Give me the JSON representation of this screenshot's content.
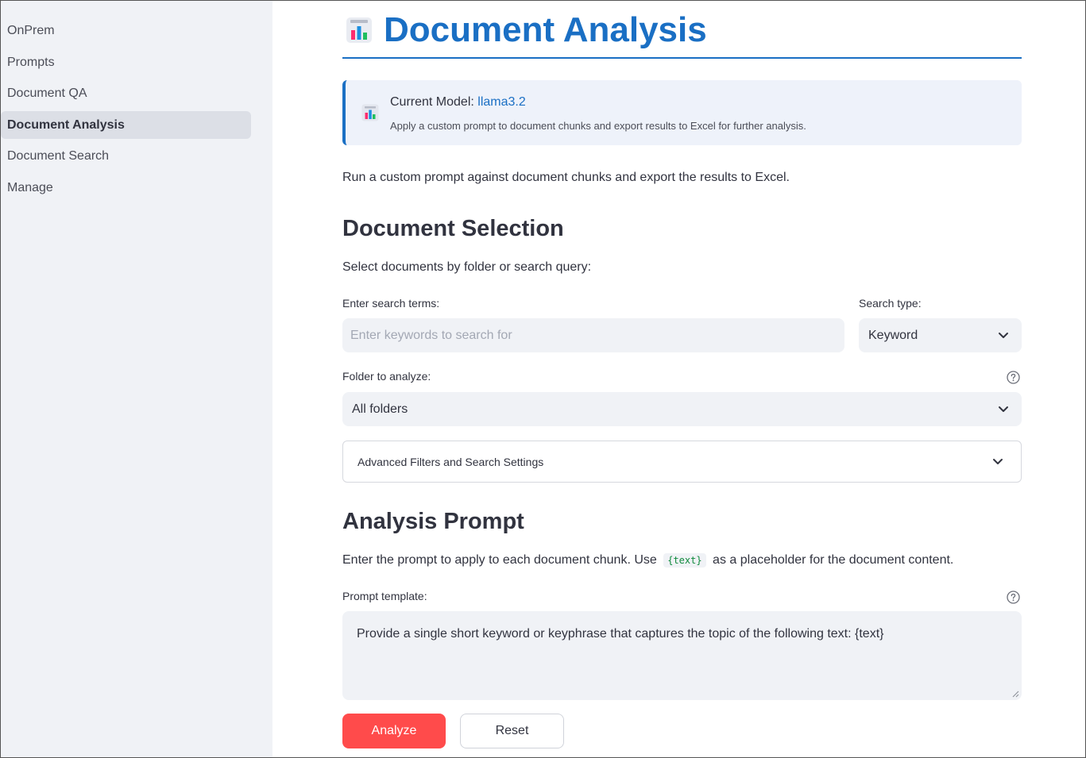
{
  "sidebar": {
    "items": [
      {
        "label": "OnPrem",
        "active": false
      },
      {
        "label": "Prompts",
        "active": false
      },
      {
        "label": "Document QA",
        "active": false
      },
      {
        "label": "Document Analysis",
        "active": true
      },
      {
        "label": "Document Search",
        "active": false
      },
      {
        "label": "Manage",
        "active": false
      }
    ]
  },
  "header": {
    "icon": "bar-chart-icon",
    "title": "Document Analysis"
  },
  "info": {
    "icon": "bar-chart-icon",
    "model_prefix": "Current Model:",
    "model_name": "llama3.2",
    "description": "Apply a custom prompt to document chunks and export results to Excel for further analysis."
  },
  "intro": "Run a custom prompt against document chunks and export the results to Excel.",
  "selection": {
    "heading": "Document Selection",
    "subtext": "Select documents by folder or search query:",
    "search_label": "Enter search terms:",
    "search_placeholder": "Enter keywords to search for",
    "search_value": "",
    "search_type_label": "Search type:",
    "search_type_value": "Keyword",
    "folder_label": "Folder to analyze:",
    "folder_value": "All folders",
    "expander_label": "Advanced Filters and Search Settings"
  },
  "prompt": {
    "heading": "Analysis Prompt",
    "subtext_before": "Enter the prompt to apply to each document chunk. Use",
    "code": "{text}",
    "subtext_after": "as a placeholder for the document content.",
    "template_label": "Prompt template:",
    "template_value": "Provide a single short keyword or keyphrase that captures the topic of the following text: {text}"
  },
  "buttons": {
    "analyze": "Analyze",
    "reset": "Reset"
  },
  "colors": {
    "accent": "#1a6fc4",
    "primary_button": "#ff4b4b",
    "sidebar_bg": "#f0f2f6",
    "code_text": "#0f8a3c"
  }
}
